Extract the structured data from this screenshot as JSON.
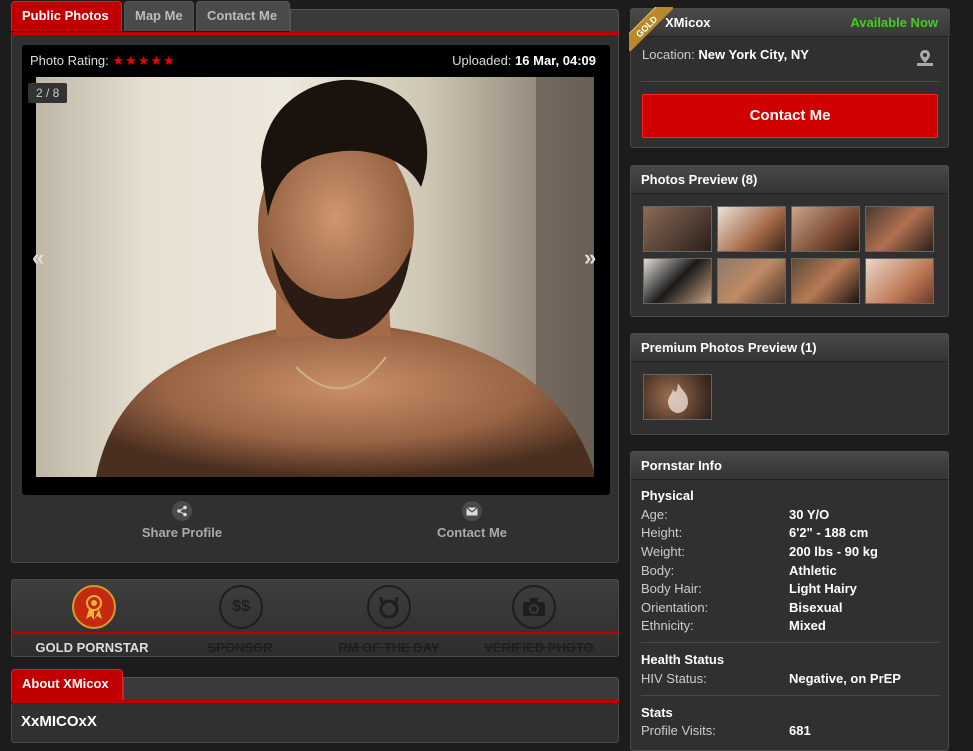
{
  "tabs": [
    {
      "label": "Public Photos"
    },
    {
      "label": "Map Me"
    },
    {
      "label": "Contact Me"
    }
  ],
  "photo": {
    "rating_label": "Photo Rating:",
    "rating_stars": "★★★★★",
    "uploaded_label": "Uploaded:",
    "uploaded_value": "16 Mar, 04:09",
    "counter": "2 / 8",
    "prev": "«",
    "next": "»"
  },
  "actions": {
    "share": "Share Profile",
    "contact": "Contact Me"
  },
  "badges": [
    {
      "label": "GOLD PORNSTAR",
      "active": true,
      "icon": "award-icon"
    },
    {
      "label": "SPONSOR",
      "active": false,
      "icon": "dollar-icon",
      "glyph": "$$"
    },
    {
      "label": "RM OF THE DAY",
      "active": false,
      "icon": "horns-icon"
    },
    {
      "label": "VERIFIED PHOTO",
      "active": false,
      "icon": "camera-icon"
    }
  ],
  "about": {
    "tab": "About XMicox",
    "username": "XxMICOxX"
  },
  "profile": {
    "gold_ribbon": "GOLD",
    "name": "XMicox",
    "status": "Available Now",
    "location_label": "Location:",
    "location_value": "New York City, NY",
    "contact_button": "Contact Me"
  },
  "photos_preview": {
    "title": "Photos Preview (8)"
  },
  "premium_preview": {
    "title": "Premium Photos Preview (1)"
  },
  "info": {
    "title": "Pornstar Info",
    "physical_title": "Physical",
    "physical": [
      {
        "k": "Age:",
        "v": "30 Y/O"
      },
      {
        "k": "Height:",
        "v": "6'2\" - 188 cm"
      },
      {
        "k": "Weight:",
        "v": "200 lbs - 90 kg"
      },
      {
        "k": "Body:",
        "v": "Athletic"
      },
      {
        "k": "Body Hair:",
        "v": "Light Hairy"
      },
      {
        "k": "Orientation:",
        "v": "Bisexual"
      },
      {
        "k": "Ethnicity:",
        "v": "Mixed"
      }
    ],
    "health_title": "Health Status",
    "health": [
      {
        "k": "HIV Status:",
        "v": "Negative, on PrEP"
      }
    ],
    "stats_title": "Stats",
    "stats": [
      {
        "k": "Profile Visits:",
        "v": "681"
      }
    ]
  },
  "colors": {
    "accent": "#c00000",
    "available": "#44cc22",
    "gold": "#d79a2a"
  }
}
